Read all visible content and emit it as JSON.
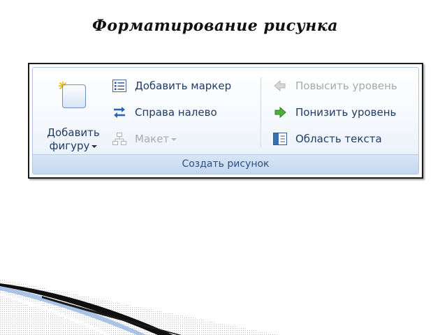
{
  "slide": {
    "title": "Форматирование рисунка"
  },
  "ribbon": {
    "group_caption": "Создать рисунок",
    "add_shape": {
      "label_line1": "Добавить",
      "label_line2": "фигуру",
      "icon": "shape-square-icon"
    },
    "commands": [
      {
        "label": "Добавить маркер",
        "icon": "bullet-list-icon",
        "enabled": true
      },
      {
        "label": "Справа налево",
        "icon": "swap-arrows-icon",
        "enabled": true
      },
      {
        "label": "Макет",
        "icon": "org-chart-icon",
        "enabled": false,
        "has_dropdown": true
      },
      {
        "label": "Повысить уровень",
        "icon": "arrow-left-icon",
        "enabled": false
      },
      {
        "label": "Понизить уровень",
        "icon": "arrow-right-icon",
        "enabled": true
      },
      {
        "label": "Область текста",
        "icon": "text-pane-icon",
        "enabled": true
      }
    ]
  },
  "colors": {
    "text_enabled": "#1f3b64",
    "text_disabled": "#a9a9a9",
    "caption_text": "#2f4f7f",
    "caption_bg": "#c3d8f0",
    "arrow_green": "#3f9a2f",
    "arrow_blue": "#2a63b8"
  }
}
